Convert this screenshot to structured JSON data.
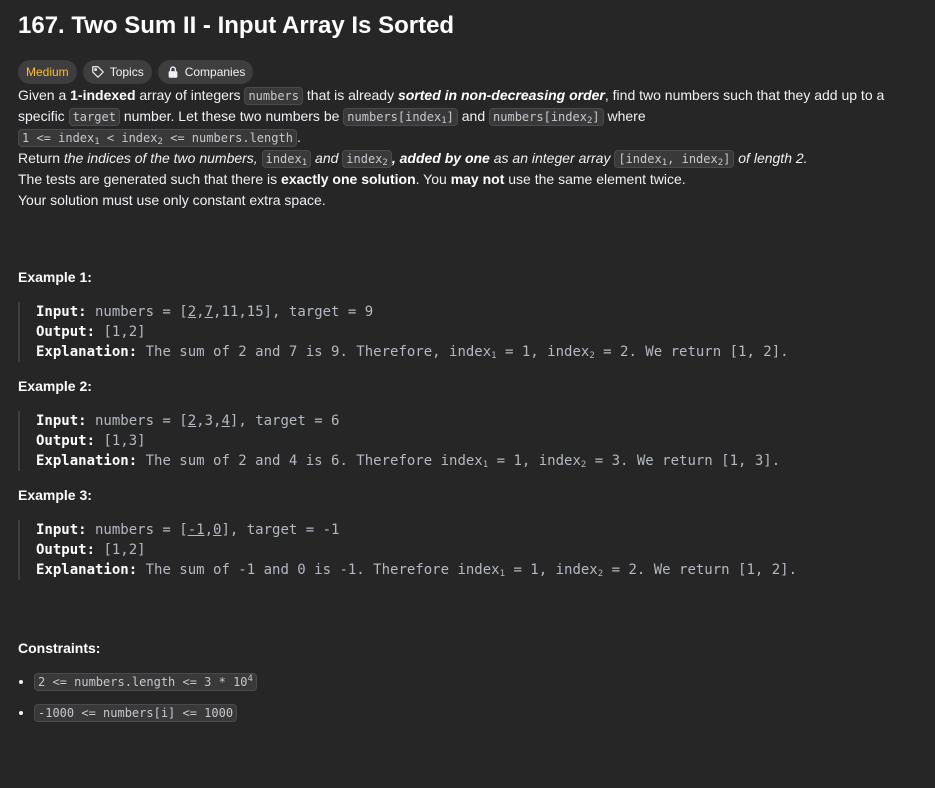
{
  "problem": {
    "title": "167. Two Sum II - Input Array Is Sorted",
    "tags": {
      "difficulty": "Medium",
      "topics": "Topics",
      "companies": "Companies"
    }
  },
  "description": {
    "p1": {
      "t1": "Given a ",
      "b1": "1-indexed",
      "t2": " array of integers ",
      "c1": "numbers",
      "t3": " that is already ",
      "bi1": "sorted in non-decreasing order",
      "t4": ", find two numbers such that they add up to a specific ",
      "c2": "target",
      "t5": " number. Let these two numbers be ",
      "c3a": "numbers[index",
      "c3s": "1",
      "c3b": "]",
      "t6": " and ",
      "c4a": "numbers[index",
      "c4s": "2",
      "c4b": "]",
      "t7": " where ",
      "c5a": "1 <= index",
      "c5s1": "1",
      "c5b": " < index",
      "c5s2": "2",
      "c5c": " <= numbers.length",
      "t8": "."
    },
    "p2": {
      "t1": "Return ",
      "i1": "the indices of the two numbers, ",
      "c1a": "index",
      "c1s": "1",
      "i2": " and ",
      "c2a": "index",
      "c2s": "2",
      "bi1": ", added by one",
      "i3": " as an integer array ",
      "c3a": "[index",
      "c3s1": "1",
      "c3b": ", index",
      "c3s2": "2",
      "c3c": "]",
      "i4": " of length 2."
    },
    "p3": {
      "t1": "The tests are generated such that there is ",
      "b1": "exactly one solution",
      "t2": ". You ",
      "b2": "may not",
      "t3": " use the same element twice."
    },
    "p4": "Your solution must use only constant extra space."
  },
  "examples": [
    {
      "title": "Example 1:",
      "input_label": "Input:",
      "input_pre": " numbers = [",
      "input_u1": "2",
      "input_mid1": ",",
      "input_u2": "7",
      "input_post": ",11,15], target = 9",
      "output_label": "Output:",
      "output": " [1,2]",
      "expl_label": "Explanation:",
      "expl_a": " The sum of 2 and 7 is 9. Therefore, index",
      "expl_s1": "1",
      "expl_b": " = 1, index",
      "expl_s2": "2",
      "expl_c": " = 2. We return [1, 2]."
    },
    {
      "title": "Example 2:",
      "input_label": "Input:",
      "input_pre": " numbers = [",
      "input_u1": "2",
      "input_mid1": ",3,",
      "input_u2": "4",
      "input_post": "], target = 6",
      "output_label": "Output:",
      "output": " [1,3]",
      "expl_label": "Explanation:",
      "expl_a": " The sum of 2 and 4 is 6. Therefore index",
      "expl_s1": "1",
      "expl_b": " = 1, index",
      "expl_s2": "2",
      "expl_c": " = 3. We return [1, 3]."
    },
    {
      "title": "Example 3:",
      "input_label": "Input:",
      "input_pre": " numbers = [",
      "input_u1": "-1",
      "input_mid1": ",",
      "input_u2": "0",
      "input_post": "], target = -1",
      "output_label": "Output:",
      "output": " [1,2]",
      "expl_label": "Explanation:",
      "expl_a": " The sum of -1 and 0 is -1. Therefore index",
      "expl_s1": "1",
      "expl_b": " = 1, index",
      "expl_s2": "2",
      "expl_c": " = 2. We return [1, 2]."
    }
  ],
  "constraints": {
    "title": "Constraints:",
    "c1a": "2 <= numbers.length <= 3 * 10",
    "c1sup": "4",
    "c2": "-1000 <= numbers[i] <= 1000"
  },
  "colors": {
    "background": "#262626",
    "difficulty_medium": "#ffc01e",
    "tag_bg": "#3e3e3e"
  },
  "icons": {
    "topics": "tag-icon",
    "companies": "lock-icon"
  }
}
